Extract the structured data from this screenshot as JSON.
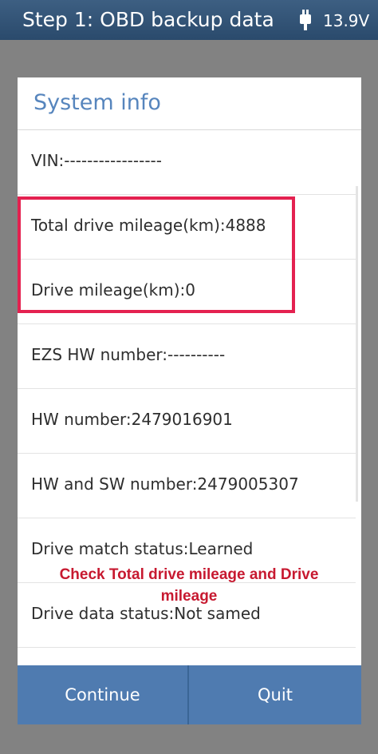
{
  "header": {
    "title": "Step 1: OBD backup data",
    "voltage": "13.9V",
    "battery_icon": "usb-plug-icon"
  },
  "dialog": {
    "title": "System info",
    "rows": [
      "VIN:-----------------",
      "Total drive mileage(km):4888",
      "Drive mileage(km):0",
      "EZS HW number:----------",
      "HW number:2479016901",
      "HW and SW number:2479005307",
      "Drive match status:Learned",
      "Drive data status:Not samed"
    ],
    "annotation": "Check Total drive mileage and Drive mileage",
    "buttons": {
      "continue": "Continue",
      "quit": "Quit"
    }
  },
  "colors": {
    "header_bg": "#2f5074",
    "title_text": "#5685bd",
    "highlight": "#e42150",
    "annotation": "#c71930",
    "button_bg": "#4f7bb0"
  }
}
